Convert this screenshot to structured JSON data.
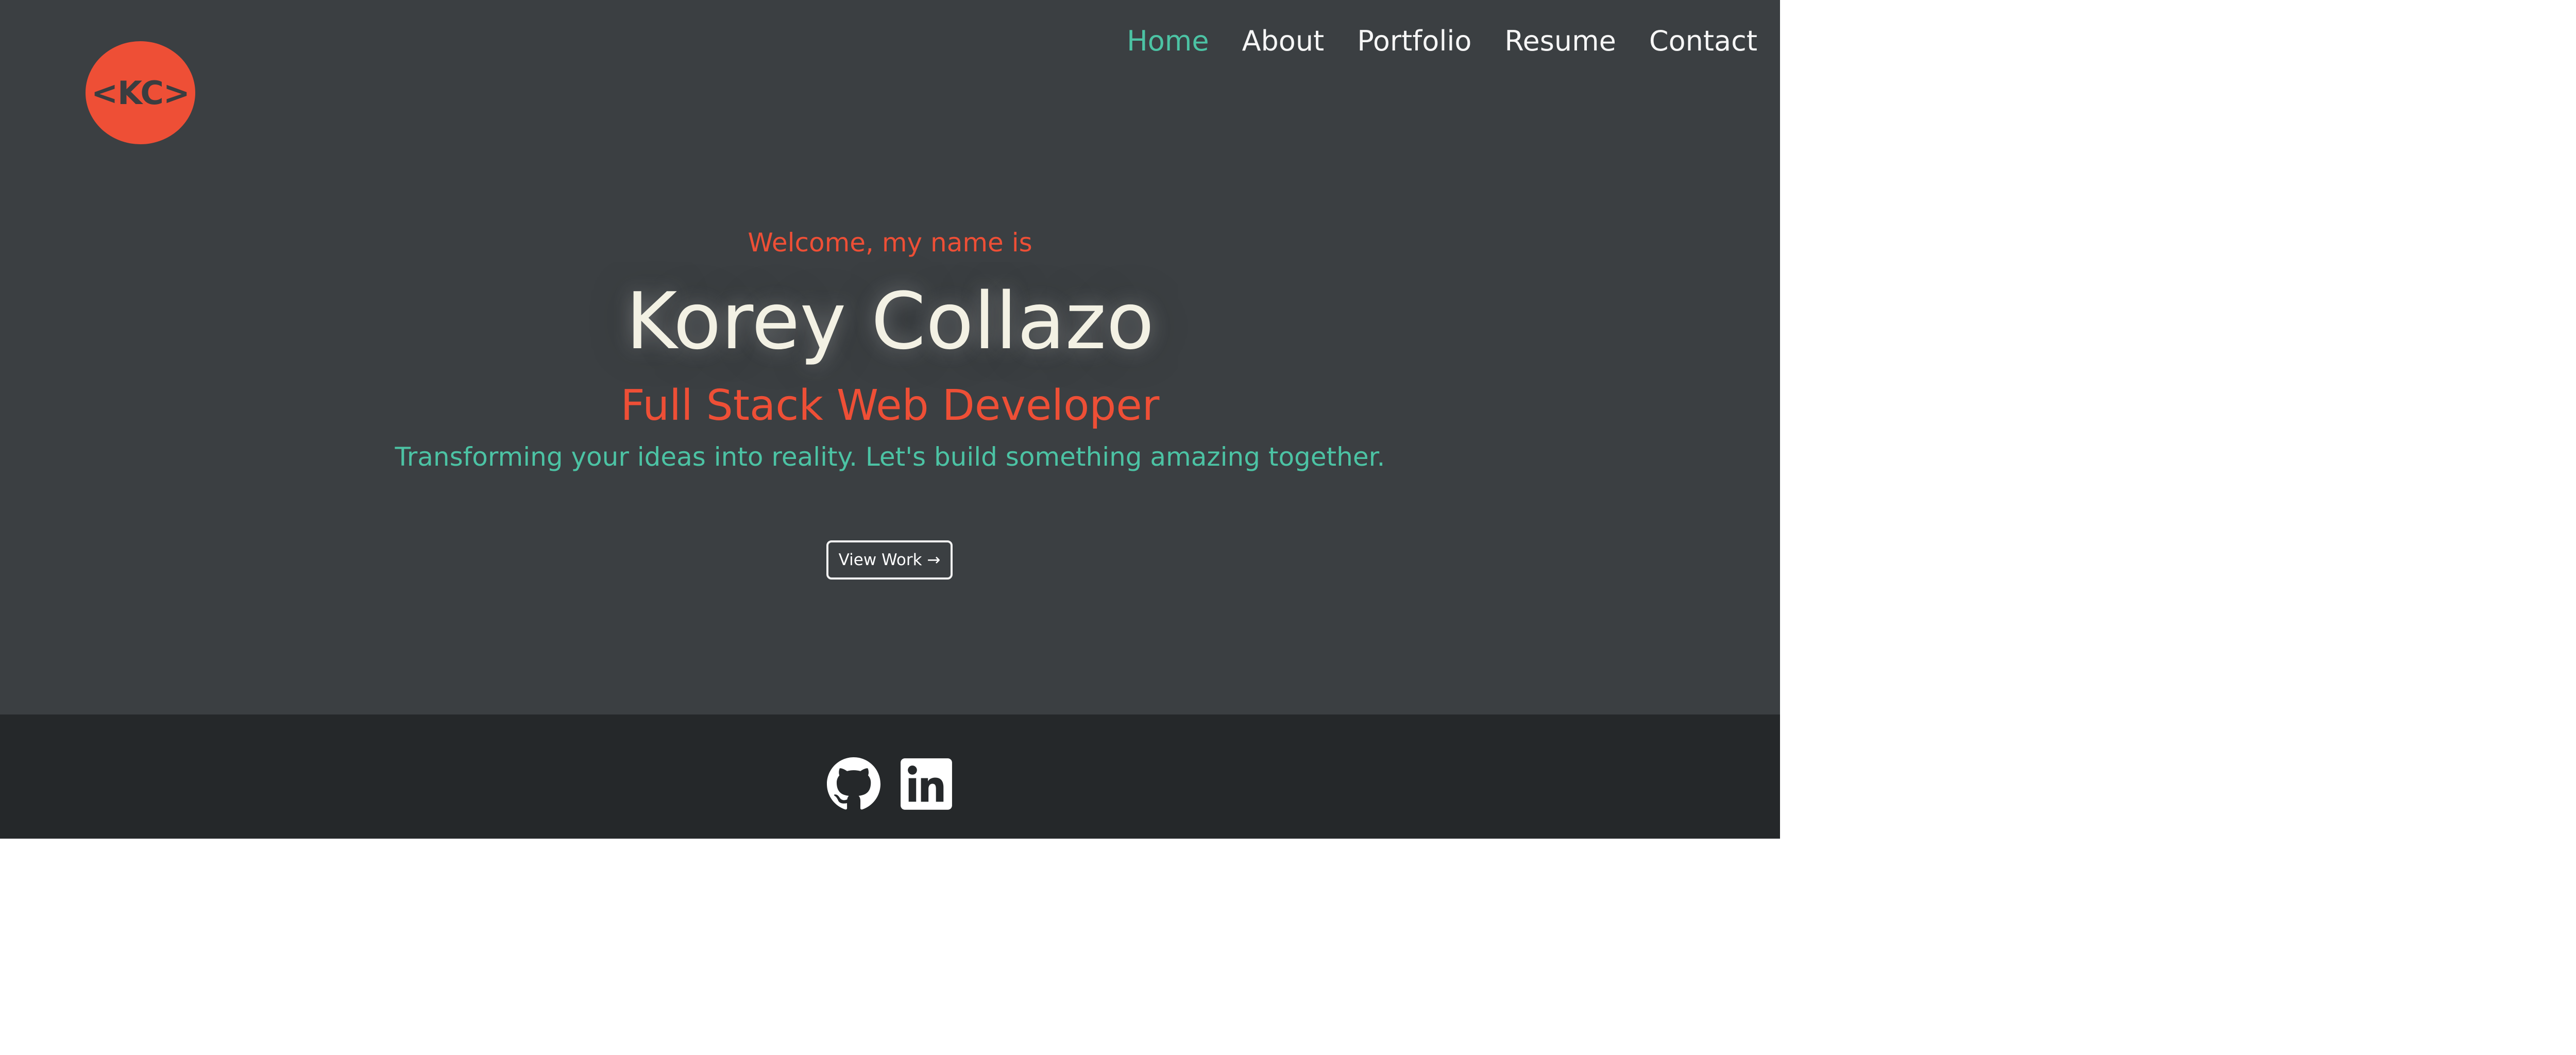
{
  "logo": {
    "text": "<KC>"
  },
  "nav": {
    "items": [
      {
        "label": "Home",
        "active": true
      },
      {
        "label": "About",
        "active": false
      },
      {
        "label": "Portfolio",
        "active": false
      },
      {
        "label": "Resume",
        "active": false
      },
      {
        "label": "Contact",
        "active": false
      }
    ]
  },
  "hero": {
    "greeting": "Welcome, my name is",
    "name": "Korey Collazo",
    "role": "Full Stack Web Developer",
    "tagline": "Transforming your ideas into reality. Let's build something amazing together.",
    "cta_label": "View Work →"
  },
  "footer": {
    "social": [
      {
        "icon": "github-icon"
      },
      {
        "icon": "linkedin-icon"
      }
    ]
  },
  "colors": {
    "hero_bg": "#3b3f42",
    "footer_bg": "#25282a",
    "accent_orange": "#ee4f36",
    "accent_teal": "#4cc3a4",
    "name_text": "#f3f1e4"
  }
}
